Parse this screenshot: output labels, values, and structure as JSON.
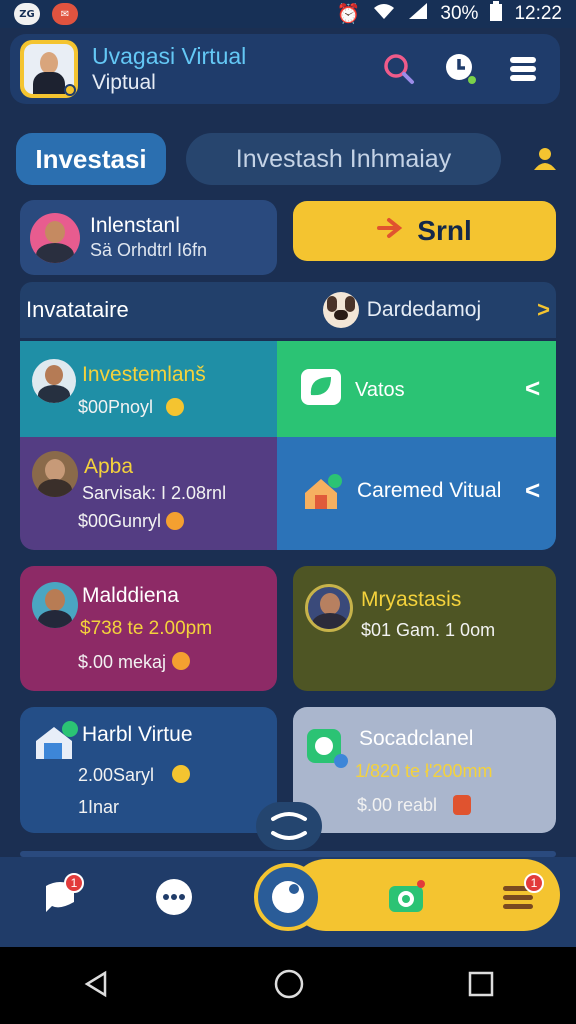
{
  "status_bar": {
    "battery": "30%",
    "time": "12:22"
  },
  "app": {
    "title_line1": "Uvagasi Virtual",
    "title_line2": "Viptual"
  },
  "tabs": {
    "active": "Investasi",
    "inactive": "Investash Inhmaiay"
  },
  "profile": {
    "name": "Inlenstanl",
    "subtitle": "Sä Orhdtrl I6fn"
  },
  "cta": {
    "label": "Srnl"
  },
  "section": {
    "title": "Invatataire",
    "right_label": "Dardedamoj"
  },
  "grid": [
    {
      "title": "Investemlanš",
      "amount": "$00Pnoyl"
    },
    {
      "title": "Vatos"
    },
    {
      "title": "Apba",
      "line1": "Sarvisak: I 2.08rnl",
      "line2": "$00Gunryl"
    },
    {
      "title": "Caremed Vitual"
    }
  ],
  "cards": [
    {
      "title": "Malddiena",
      "line1": "$738 te 2.00pm",
      "line2": "$.00 mekaj"
    },
    {
      "title": "Mryastasis",
      "line1": "$01 Gam.  1 0om"
    },
    {
      "title": "Harbl Virtue",
      "line1": "2.00Saryl",
      "line2": "1Inar"
    },
    {
      "title": "Socadclanel",
      "line1": "1/820 te ł'200mm",
      "line2": "$.00 reabl"
    }
  ],
  "nav_badges": {
    "chat": "1",
    "menu": "1"
  },
  "icons": [
    "search-icon",
    "clock-icon",
    "menu-icon",
    "user-icon",
    "arrow-icon",
    "chevron-right-icon",
    "chevron-left-icon",
    "chat-icon",
    "more-icon",
    "home-icon",
    "camera-icon",
    "list-icon",
    "back-icon",
    "circle-icon",
    "square-icon"
  ],
  "colors": {
    "yellow": "#f4c430",
    "navy": "#1b2f52",
    "green": "#2bc374",
    "teal": "#1f8fa6",
    "purple": "#543d83",
    "blue": "#2c73b8",
    "magenta": "#8d2a66",
    "olive": "#4e5524"
  }
}
